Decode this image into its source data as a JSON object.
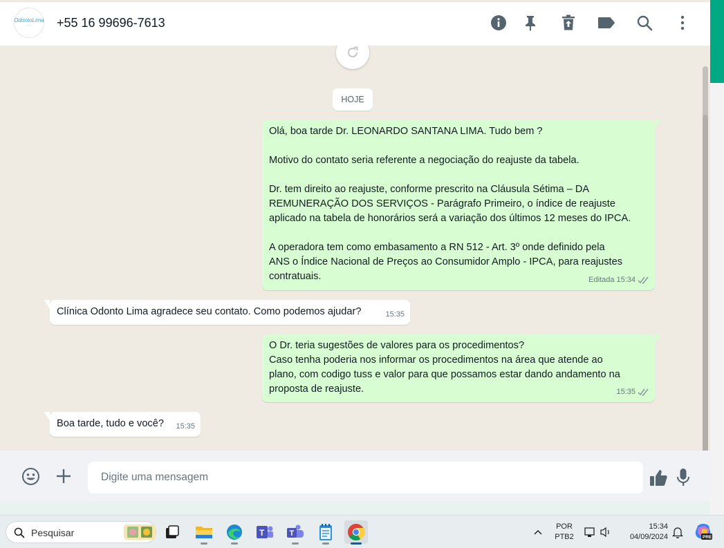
{
  "header": {
    "contact_name": "+55 16 99696-7613",
    "avatar_logo": "OdontoLima",
    "icons": [
      "info-icon",
      "pin-icon",
      "delete-icon",
      "label-icon",
      "search-icon",
      "menu-icon"
    ]
  },
  "chat": {
    "date_divider": "HOJE",
    "messages": [
      {
        "direction": "out",
        "text": "Olá, boa tarde Dr. LEONARDO SANTANA LIMA. Tudo bem ?\n\nMotivo do contato seria referente a negociação do reajuste da tabela.\n\nDr. tem direito ao reajuste, conforme prescrito na Cláusula Sétima – DA\nREMUNERAÇÃO DOS SERVIÇOS - Parágrafo Primeiro, o índice de reajuste\naplicado na tabela de honorários será a variação dos últimos 12 meses do IPCA.\n\nA operadora tem como embasamento a RN 512 - Art. 3º onde definido pela\nANS o Índice Nacional de Preços ao Consumidor Amplo - IPCA, para reajustes\ncontratuais.",
        "edited_label": "Editada",
        "time": "15:34"
      },
      {
        "direction": "in",
        "text": "Clínica Odonto Lima agradece seu contato. Como podemos ajudar?",
        "time": "15:35"
      },
      {
        "direction": "out",
        "text": "O Dr. teria sugestões de valores para os procedimentos?\nCaso tenha poderia nos informar os procedimentos na área que atende ao\nplano, com codigo tuss e valor para que possamos estar dando andamento na\nproposta de reajuste.",
        "time": "15:35"
      },
      {
        "direction": "in",
        "text": "Boa tarde, tudo e você?",
        "time": "15:35"
      }
    ]
  },
  "composer": {
    "placeholder": "Digite uma mensagem"
  },
  "taskbar": {
    "search_label": "Pesquisar",
    "lang_line1": "POR",
    "lang_line2": "PTB2",
    "time": "15:34",
    "date": "04/09/2024",
    "copilot_badge": "PRE"
  },
  "colors": {
    "accent": "#00a884",
    "outgoing_bubble": "#d9fdd3",
    "incoming_bubble": "#ffffff",
    "chat_background": "#efeae2",
    "read_ticks": "#8696a0"
  }
}
